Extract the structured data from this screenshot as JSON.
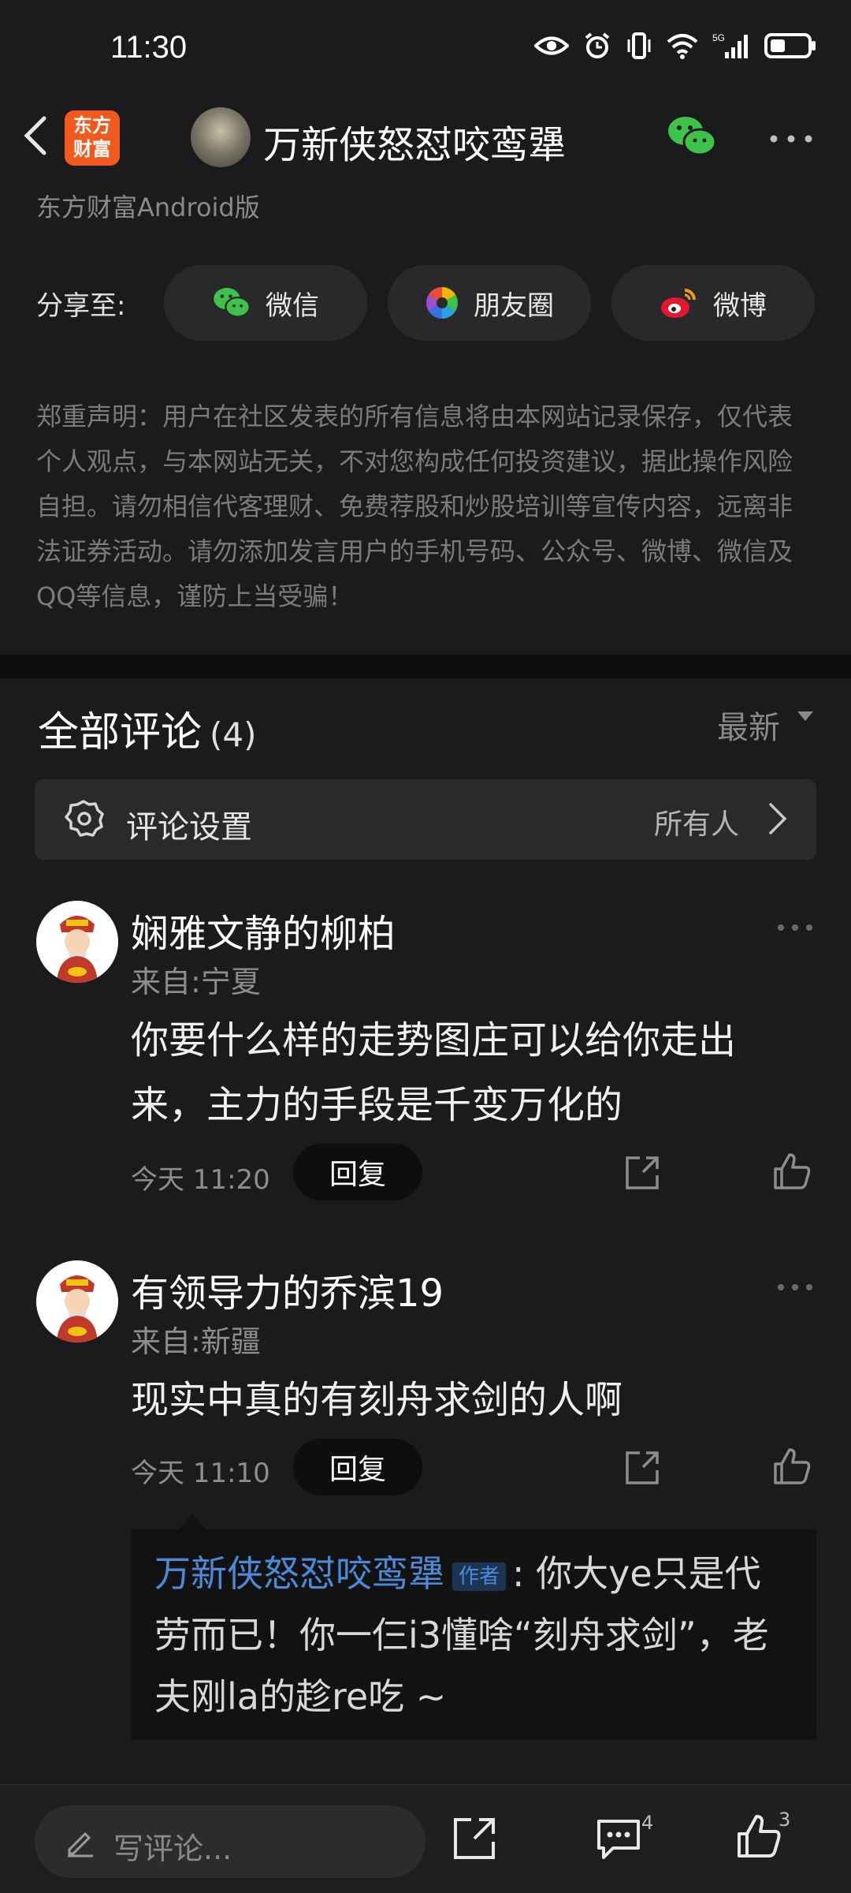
{
  "status_bar": {
    "time": "11:30",
    "signal_label": "5G"
  },
  "header": {
    "logo_line1": "东方",
    "logo_line2": "财富",
    "title": "万新侠怒怼咬鸾犟"
  },
  "source_text": "东方财富Android版",
  "share": {
    "label": "分享至:",
    "wechat": "微信",
    "moments": "朋友圈",
    "weibo": "微博"
  },
  "disclaimer": "郑重声明：用户在社区发表的所有信息将由本网站记录保存，仅代表个人观点，与本网站无关，不对您构成任何投资建议，据此操作风险自担。请勿相信代客理财、免费荐股和炒股培训等宣传内容，远离非法证券活动。请勿添加发言用户的手机号码、公众号、微博、微信及QQ等信息，谨防上当受骗！",
  "comments": {
    "title": "全部评论",
    "count": "(4)",
    "sort_label": "最新",
    "settings_label": "评论设置",
    "settings_value": "所有人",
    "items": [
      {
        "name": "娴雅文静的柳柏",
        "location": "来自:宁夏",
        "body": "你要什么样的走势图庄可以给你走出来，主力的手段是千变万化的",
        "time": "今天 11:20",
        "reply_label": "回复"
      },
      {
        "name": "有领导力的乔滨19",
        "location": "来自:新疆",
        "body": "现实中真的有刻舟求剑的人啊",
        "time": "今天 11:10",
        "reply_label": "回复"
      }
    ],
    "author_reply": {
      "author": "万新侠怒怼咬鸾犟",
      "tag": "作者",
      "text": ": 你大ye只是代劳而已！你一仨i3懂啥“刻舟求剑”，老夫刚la的趁re吃 ~"
    }
  },
  "bottom_bar": {
    "placeholder": "写评论...",
    "comment_count": "4",
    "like_count": "3"
  },
  "colors": {
    "background": "#1b1b1d",
    "brand_orange": "#f15a1c",
    "author_blue": "#4a8ad8",
    "wechat_green": "#3ec34a"
  }
}
